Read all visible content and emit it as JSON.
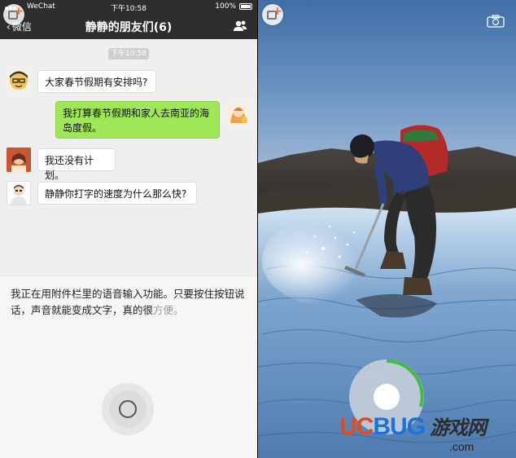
{
  "status_bar": {
    "carrier": "WeChat",
    "time": "下午10:58",
    "battery": "100%"
  },
  "nav": {
    "back_label": "微信",
    "title": "静静的朋友们(6)"
  },
  "chat": {
    "timestamp": "下午10:58",
    "messages": [
      {
        "direction": "incoming",
        "text": "大家春节假期有安排吗?"
      },
      {
        "direction": "outgoing",
        "text": "我打算春节假期和家人去南亚的海岛度假。"
      },
      {
        "direction": "incoming",
        "text": "我还没有计划。"
      },
      {
        "direction": "incoming",
        "text": "静静你打字的速度为什么那么快?"
      }
    ]
  },
  "input": {
    "text_main": "我正在用附件栏里的语音输入功能。只要按住按钮说话，声音就能变成文字，真的很",
    "text_pending": "方便。"
  },
  "watermark": {
    "brand_u": "U",
    "brand_c": "C",
    "brand_b": "B",
    "brand_u2": "U",
    "brand_g": "G",
    "brand_cn": "游戏网",
    "domain": ".com"
  },
  "colors": {
    "nav_bg": "#2e2e30",
    "outgoing_bubble": "#9fe658",
    "incoming_bubble": "#ffffff",
    "accent_orange": "#f26a1b",
    "progress_green": "#3fbf3f"
  },
  "icons": {
    "plus_badge": "add-media-icon",
    "group": "group-members-icon",
    "camera": "camera-switch-icon",
    "mic": "voice-input-icon"
  }
}
